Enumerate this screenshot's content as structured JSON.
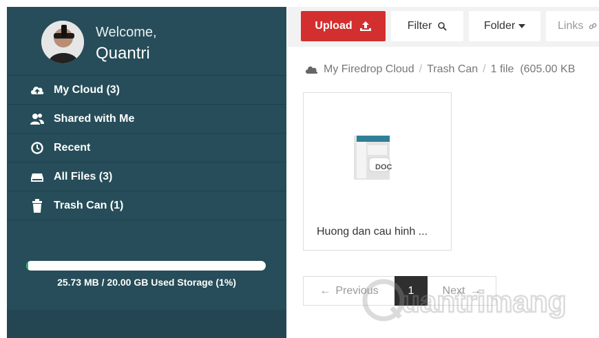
{
  "sidebar": {
    "welcome": "Welcome,",
    "username": "Quantri",
    "items": [
      {
        "label": "My Cloud (3)",
        "icon": "cloud-upload-icon"
      },
      {
        "label": "Shared with Me",
        "icon": "users-icon"
      },
      {
        "label": "Recent",
        "icon": "clock-icon"
      },
      {
        "label": "All Files (3)",
        "icon": "drive-icon"
      },
      {
        "label": "Trash Can (1)",
        "icon": "trash-icon"
      }
    ],
    "storage": {
      "text": "25.73 MB / 20.00 GB Used Storage (1%)",
      "percent": 1
    }
  },
  "toolbar": {
    "upload": "Upload",
    "filter": "Filter",
    "folder": "Folder",
    "links": "Links"
  },
  "breadcrumb": {
    "root": "My Firedrop Cloud",
    "current": "Trash Can",
    "info": "1 file  (605.00 KB"
  },
  "files": [
    {
      "name": "Huong dan cau hinh ...",
      "badge": "DOC",
      "icon": "doc-file-icon"
    }
  ],
  "pagination": {
    "previous": "Previous",
    "page": "1",
    "next": "Next"
  },
  "watermark": {
    "text": "uantrimang"
  },
  "colors": {
    "sidebar": "#264d59",
    "upload": "#d32f2f",
    "storage_fill": "#25b36b",
    "doc_bar": "#2f7f98"
  }
}
